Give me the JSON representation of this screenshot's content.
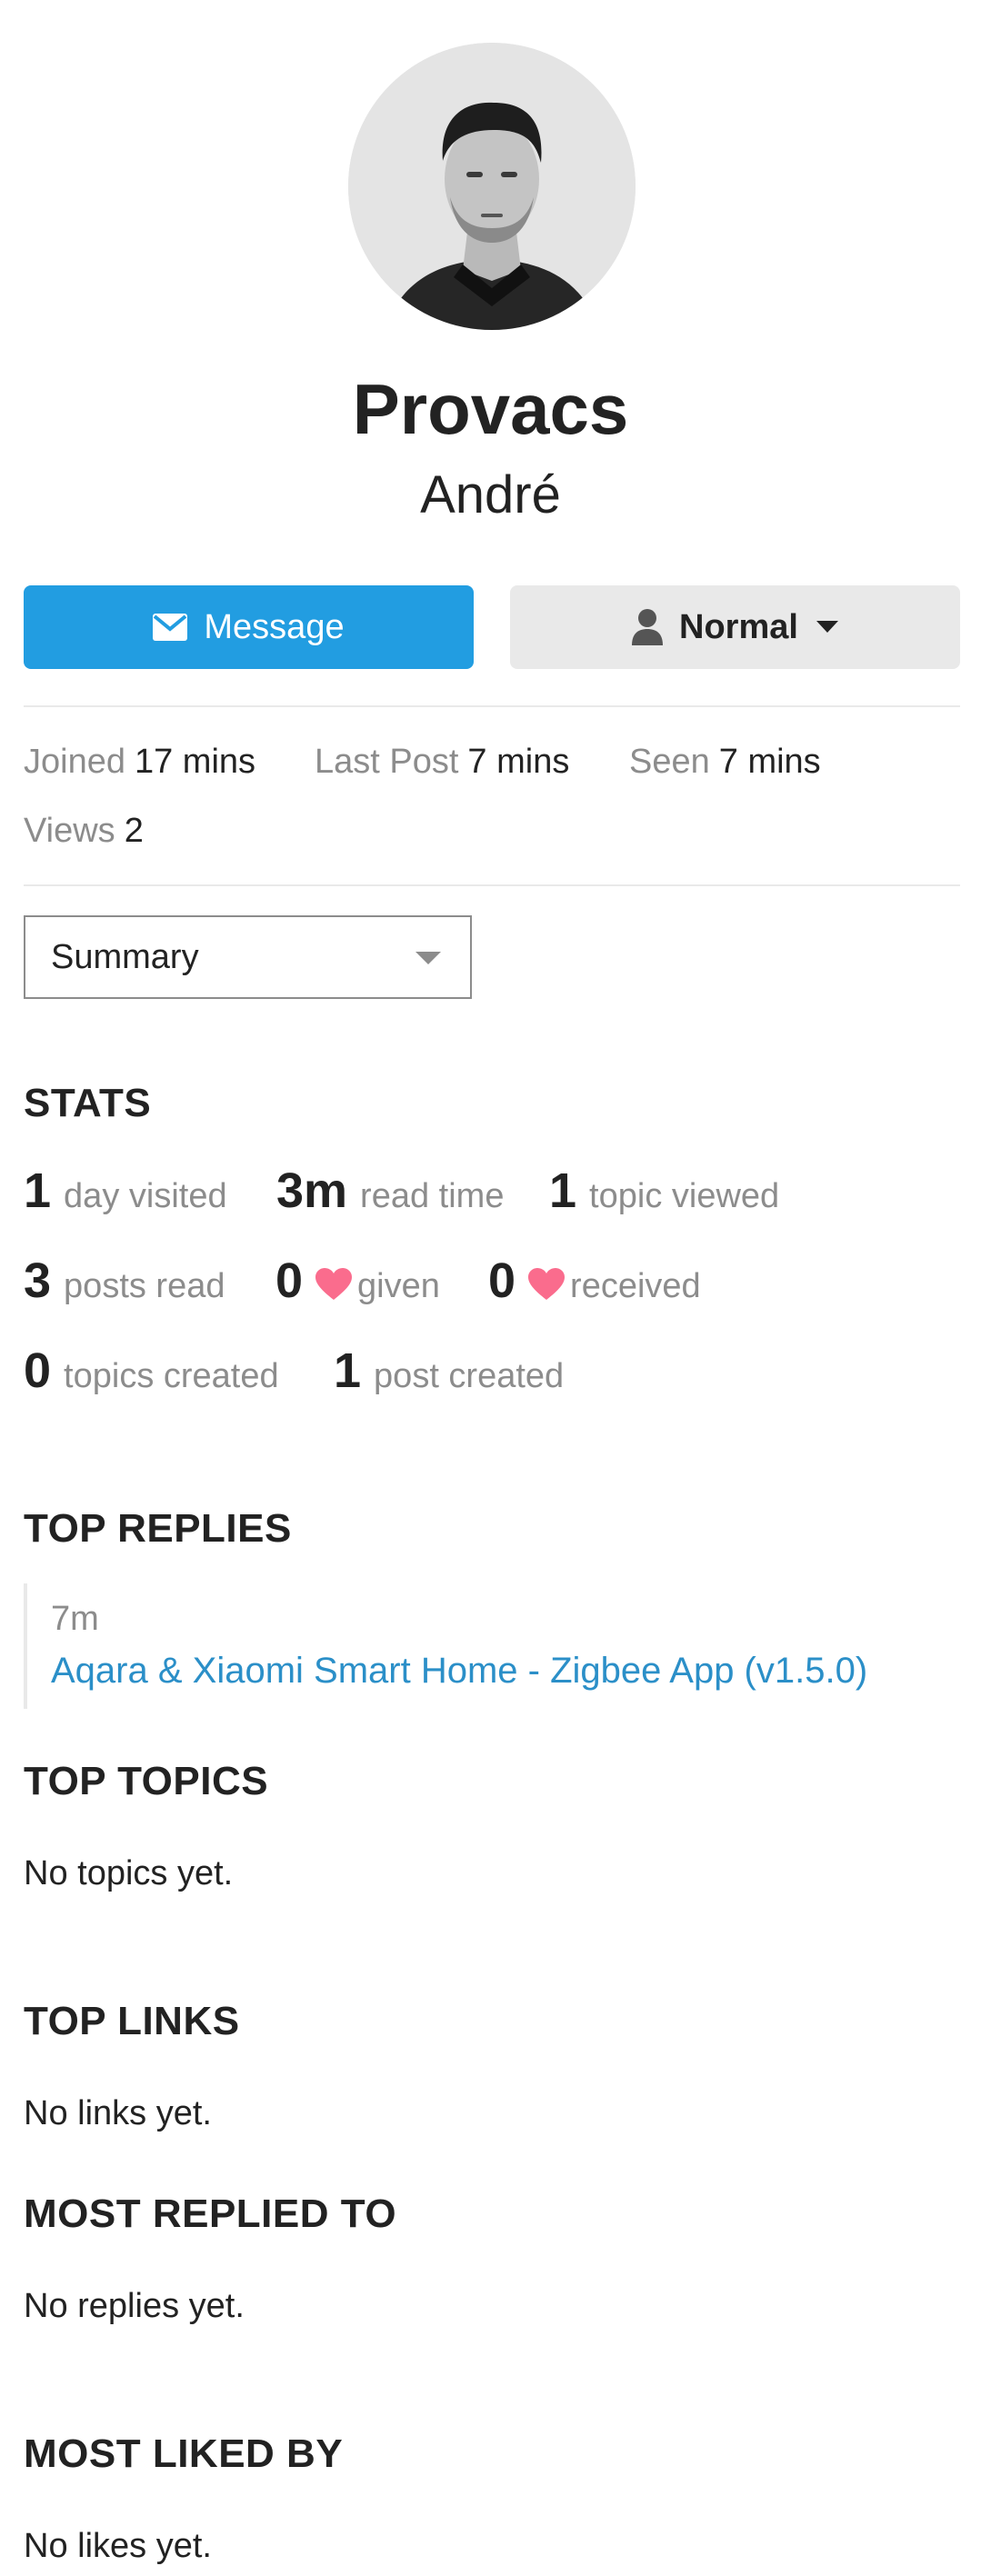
{
  "profile": {
    "username": "Provacs",
    "full_name": "André"
  },
  "actions": {
    "message_label": "Message",
    "trust_label": "Normal"
  },
  "meta": {
    "joined_label": "Joined",
    "joined_value": "17 mins",
    "last_post_label": "Last Post",
    "last_post_value": "7 mins",
    "seen_label": "Seen",
    "seen_value": "7 mins",
    "views_label": "Views",
    "views_value": "2"
  },
  "view_select": {
    "selected": "Summary"
  },
  "stats": {
    "title": "STATS",
    "days_visited": {
      "value": "1",
      "label": "day visited"
    },
    "read_time": {
      "value": "3m",
      "label": "read time"
    },
    "topics_viewed": {
      "value": "1",
      "label": "topic viewed"
    },
    "posts_read": {
      "value": "3",
      "label": "posts read"
    },
    "likes_given": {
      "value": "0",
      "label": "given"
    },
    "likes_received": {
      "value": "0",
      "label": "received"
    },
    "topics_created": {
      "value": "0",
      "label": "topics created"
    },
    "posts_created": {
      "value": "1",
      "label": "post created"
    }
  },
  "top_replies": {
    "title": "TOP REPLIES",
    "items": [
      {
        "time": "7m",
        "topic": "Aqara & Xiaomi Smart Home - Zigbee App (v1.5.0)"
      }
    ]
  },
  "top_topics": {
    "title": "TOP TOPICS",
    "empty": "No topics yet."
  },
  "top_links": {
    "title": "TOP LINKS",
    "empty": "No links yet."
  },
  "most_replied_to": {
    "title": "MOST REPLIED TO",
    "empty": "No replies yet."
  },
  "most_liked_by": {
    "title": "MOST LIKED BY",
    "empty": "No likes yet."
  },
  "colors": {
    "primary": "#229de1",
    "link": "#2b8fc8",
    "heart": "#fa6c8d",
    "muted": "#8c8c8c"
  },
  "icons": {
    "message": "envelope-icon",
    "trust": "user-icon",
    "caret": "caret-down-icon",
    "like": "heart-icon"
  }
}
